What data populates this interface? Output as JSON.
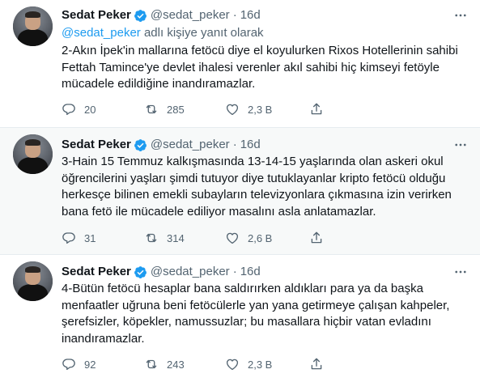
{
  "tweets": [
    {
      "name": "Sedat Peker",
      "handle": "@sedat_peker",
      "separator": "·",
      "time": "16d",
      "reply_to_mention": "@sedat_peker",
      "reply_to_suffix": " adlı kişiye yanıt olarak",
      "text": "2-Akın İpek'in mallarına fetöcü diye el koyulurken Rixos Hotellerinin sahibi Fettah Tamince'ye devlet ihalesi verenler akıl sahibi hiç kimseyi fetöyle mücadele edildiğine inandıramazlar.",
      "replies": "20",
      "retweets": "285",
      "likes": "2,3 B"
    },
    {
      "name": "Sedat Peker",
      "handle": "@sedat_peker",
      "separator": "·",
      "time": "16d",
      "text": "3-Hain 15 Temmuz kalkışmasında 13-14-15 yaşlarında olan askeri okul öğrencilerini yaşları şimdi tutuyor diye tutuklayanlar kripto fetöcü olduğu herkesçe bilinen emekli subayların televizyonlara çıkmasına izin verirken bana fetö ile mücadele ediliyor masalını asla anlatamazlar.",
      "replies": "31",
      "retweets": "314",
      "likes": "2,6 B"
    },
    {
      "name": "Sedat Peker",
      "handle": "@sedat_peker",
      "separator": "·",
      "time": "16d",
      "text": "4-Bütün fetöcü hesaplar bana saldırırken aldıkları para ya da başka menfaatler uğruna beni fetöcülerle yan yana getirmeye çalışan kahpeler, şerefsizler, köpekler, namussuzlar; bu masallara hiçbir vatan evladını inandıramazlar.",
      "replies": "92",
      "retweets": "243",
      "likes": "2,3 B"
    }
  ],
  "colors": {
    "accent": "#1d9bf0",
    "secondary_text": "#536471",
    "primary_text": "#0f1419",
    "divider": "#e6ecf0",
    "hover_bg": "#f7f9f9"
  },
  "icons": {
    "verified": "verified-badge-icon",
    "more": "more-options-icon",
    "reply": "reply-icon",
    "retweet": "retweet-icon",
    "like": "heart-icon",
    "share": "share-icon"
  }
}
